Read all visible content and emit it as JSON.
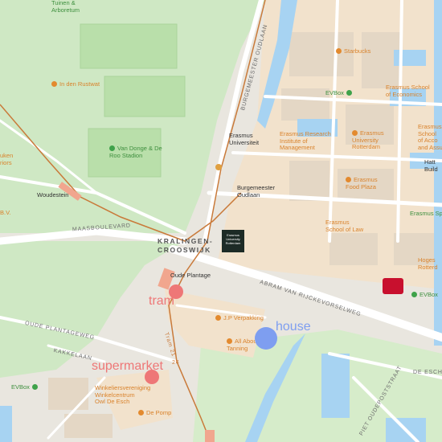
{
  "map": {
    "colors": {
      "land": "#e9e6df",
      "park": "#cfe8c4",
      "water": "#a7d3f2",
      "campus": "#f2e2cc",
      "road": "#ffffff",
      "rail": "#c97a3a",
      "poi_orange": "#d9822b",
      "poi_green": "#3e8f3e"
    },
    "poi": {
      "tuinen": "Tuinen &\nArboretum",
      "in_den_rustwat": "In den Rustwat",
      "van_donge": "Van Donge & De\nRoo Stadion",
      "starbucks": "Starbucks",
      "evbox_top": "EVBox",
      "erasmus_economics": "Erasmus School\nof Economics",
      "erasmus_research": "Erasmus Research\nInstitute of\nManagement",
      "erasmus_university_rotterdam": "Erasmus\nUniversity\nRotterdam",
      "erasmus_accounting": "Erasmus\nSchool\nof Acco\nand Assu",
      "hatta_building": "Hatt\nBuild",
      "erasmus_food_plaza": "Erasmus\nFood Plaza",
      "erasmus_law": "Erasmus\nSchool of Law",
      "erasmus_sport": "Erasmus Sport",
      "hogeschool": "Hoges\nRotterd",
      "evbox_right": "EVBox",
      "jp_verpakking": "J.P Verpakking",
      "all_about_tanning": "All About\nTanning",
      "winkelcentrum": "Winkeliersvereniging\nWinkelcentrum\nOwl De Esch",
      "de_pomp": "De Pomp",
      "evbox_left": "EVBox",
      "left_cut_top": "uken\nriors",
      "left_cut_bv": "B.V."
    },
    "stops": {
      "erasmus_universiteit": "Erasmus\nUniversiteit",
      "burgemeester_oudlaan": "Burgemeester\nOudlaan",
      "woudestein": "Woudestein",
      "oude_plantage": "Oude Plantage"
    },
    "streets": {
      "maasboulevard": "MAASBOULEVARD",
      "burgemeester_oudlaan": "BURGEMEESTER OUDLAAN",
      "abram_van_rijckevorselweg": "ABRAM VAN RIJCKEVORSELWEG",
      "oude_plantageweg": "OUDE PLANTAGEWEG",
      "kakkelaan": "KAKKELAAN",
      "de_esch": "DE ESCH",
      "poststraat": "PIET OUDEPOSTSTRAAT",
      "tram_21": "Tram 21",
      "tram_24": "24"
    },
    "district": "KRALINGEN-\nCROOSWIJK",
    "logo_box": "Erasmus\nUniversity\nRotterdam",
    "overlays": {
      "tram": {
        "label": "tram",
        "color": "#ee7777"
      },
      "house": {
        "label": "house",
        "color": "#7e9ef0"
      },
      "supermarket": {
        "label": "supermarket",
        "color": "#ee7777"
      }
    }
  }
}
